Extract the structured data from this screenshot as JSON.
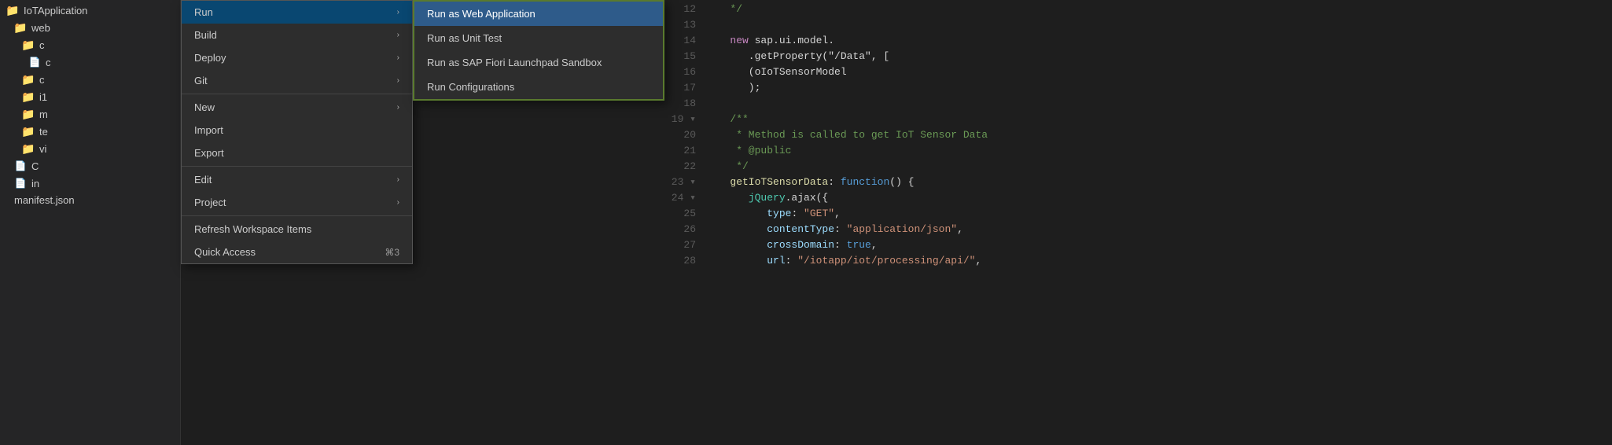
{
  "sidebar": {
    "title": "IoTApplication",
    "items": [
      {
        "label": "IoTApplication",
        "type": "folder-root",
        "icon": "folder"
      },
      {
        "label": "web",
        "type": "folder",
        "icon": "folder"
      },
      {
        "label": "c",
        "type": "folder",
        "icon": "folder"
      },
      {
        "label": "c",
        "type": "file",
        "icon": "file"
      },
      {
        "label": "c",
        "type": "folder",
        "icon": "folder-ref"
      },
      {
        "label": "i1",
        "type": "folder",
        "icon": "folder-ref"
      },
      {
        "label": "m",
        "type": "folder",
        "icon": "folder-ref"
      },
      {
        "label": "te",
        "type": "folder",
        "icon": "folder-ref"
      },
      {
        "label": "vi",
        "type": "folder",
        "icon": "folder"
      },
      {
        "label": "C",
        "type": "file",
        "icon": "file"
      },
      {
        "label": "in",
        "type": "file",
        "icon": "file"
      },
      {
        "label": "manifest.json",
        "type": "file",
        "icon": "file"
      }
    ]
  },
  "context_menu": {
    "items": [
      {
        "label": "Run",
        "has_arrow": true,
        "shortcut": ""
      },
      {
        "label": "Build",
        "has_arrow": true,
        "shortcut": ""
      },
      {
        "label": "Deploy",
        "has_arrow": true,
        "shortcut": ""
      },
      {
        "label": "Git",
        "has_arrow": true,
        "shortcut": ""
      },
      {
        "label": "New",
        "has_arrow": true,
        "shortcut": ""
      },
      {
        "label": "Import",
        "has_arrow": false,
        "shortcut": ""
      },
      {
        "label": "Export",
        "has_arrow": false,
        "shortcut": ""
      },
      {
        "label": "Edit",
        "has_arrow": true,
        "shortcut": ""
      },
      {
        "label": "Project",
        "has_arrow": true,
        "shortcut": ""
      },
      {
        "label": "Refresh Workspace Items",
        "has_arrow": false,
        "shortcut": ""
      },
      {
        "label": "Quick Access",
        "has_arrow": false,
        "shortcut": "⌘3"
      }
    ],
    "highlighted_item": "Run"
  },
  "submenu": {
    "items": [
      {
        "label": "Run as Web Application",
        "active": true
      },
      {
        "label": "Run as Unit Test",
        "active": false
      },
      {
        "label": "Run as SAP Fiori Launchpad Sandbox",
        "active": false
      },
      {
        "label": "Run Configurations",
        "active": false
      }
    ]
  },
  "editor": {
    "line_start": 12,
    "lines": [
      {
        "num": "12",
        "code": "   */",
        "tokens": [
          {
            "text": "   */",
            "class": "cm"
          }
        ]
      },
      {
        "num": "13",
        "code": "",
        "tokens": []
      },
      {
        "num": "14",
        "code": "   new sap.ui.model.",
        "tokens": [
          {
            "text": "   ",
            "class": ""
          },
          {
            "text": "new ",
            "class": "pink"
          },
          {
            "text": "sap.ui.model.",
            "class": "op"
          }
        ]
      },
      {
        "num": "15",
        "code": "   .getProperty(\"/Data\", [",
        "tokens": [
          {
            "text": "   .getProperty(\"/Data\", [",
            "class": "op"
          }
        ]
      },
      {
        "num": "16",
        "code": "   (oIoTSensorModel",
        "tokens": [
          {
            "text": "   (oIoTSensorModel",
            "class": "op"
          }
        ]
      },
      {
        "num": "17",
        "code": "   );",
        "tokens": [
          {
            "text": "   );",
            "class": "op"
          }
        ]
      },
      {
        "num": "18",
        "code": "",
        "tokens": []
      },
      {
        "num": "19",
        "code": "   /**",
        "tokens": [
          {
            "text": "   /**",
            "class": "cm"
          }
        ]
      },
      {
        "num": "20",
        "code": "    * Method is called to get IoT Sensor Data",
        "tokens": [
          {
            "text": "    * Method is called to get IoT Sensor Data",
            "class": "cm"
          }
        ]
      },
      {
        "num": "21",
        "code": "    * @public",
        "tokens": [
          {
            "text": "    * @public",
            "class": "cm"
          }
        ]
      },
      {
        "num": "22",
        "code": "    */",
        "tokens": [
          {
            "text": "    */",
            "class": "cm"
          }
        ]
      },
      {
        "num": "23",
        "code": "   getIoTSensorData: function() {",
        "tokens": [
          {
            "text": "   ",
            "class": ""
          },
          {
            "text": "getIoTSensorData",
            "class": "fn"
          },
          {
            "text": ": ",
            "class": "op"
          },
          {
            "text": "function",
            "class": "kw"
          },
          {
            "text": "() {",
            "class": "op"
          }
        ]
      },
      {
        "num": "24",
        "code": "      jQuery.ajax({",
        "tokens": [
          {
            "text": "      ",
            "class": ""
          },
          {
            "text": "jQuery",
            "class": "cl"
          },
          {
            "text": ".ajax({",
            "class": "op"
          }
        ]
      },
      {
        "num": "25",
        "code": "         type: \"GET\",",
        "tokens": [
          {
            "text": "         ",
            "class": ""
          },
          {
            "text": "type",
            "class": "nm"
          },
          {
            "text": ": ",
            "class": "op"
          },
          {
            "text": "\"GET\"",
            "class": "st"
          },
          {
            "text": ",",
            "class": "op"
          }
        ]
      },
      {
        "num": "26",
        "code": "         contentType: \"application/json\",",
        "tokens": [
          {
            "text": "         ",
            "class": ""
          },
          {
            "text": "contentType",
            "class": "nm"
          },
          {
            "text": ": ",
            "class": "op"
          },
          {
            "text": "\"application/json\"",
            "class": "st"
          },
          {
            "text": ",",
            "class": "op"
          }
        ]
      },
      {
        "num": "27",
        "code": "         crossDomain: true,",
        "tokens": [
          {
            "text": "         ",
            "class": ""
          },
          {
            "text": "crossDomain",
            "class": "nm"
          },
          {
            "text": ": ",
            "class": "op"
          },
          {
            "text": "true",
            "class": "kw"
          },
          {
            "text": ",",
            "class": "op"
          }
        ]
      },
      {
        "num": "28",
        "code": "         url: \"/iotapp/iot/processing/api/\",",
        "tokens": [
          {
            "text": "         ",
            "class": ""
          },
          {
            "text": "url",
            "class": "nm"
          },
          {
            "text": ": ",
            "class": "op"
          },
          {
            "text": "\"/iotapp/iot/processing/api/\"",
            "class": "st"
          },
          {
            "text": ",",
            "class": "op"
          }
        ]
      }
    ]
  },
  "colors": {
    "accent_blue": "#094771",
    "submenu_border": "#5a7a2e",
    "active_item_bg": "#2e5b8a"
  }
}
